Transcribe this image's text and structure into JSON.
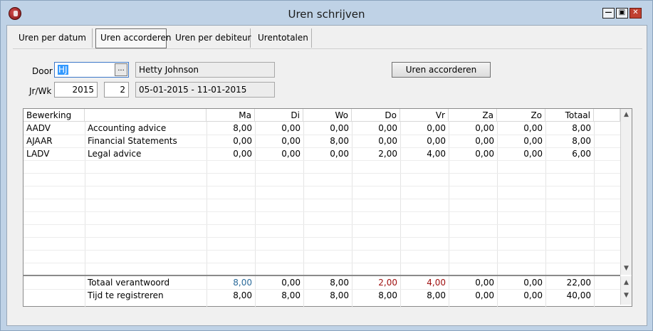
{
  "window": {
    "title": "Uren schrijven",
    "controls": {
      "minimize": "—",
      "maximize": "▣",
      "close": "✕"
    }
  },
  "tabs": [
    {
      "label": "Uren per datum",
      "active": false
    },
    {
      "label": "Uren accorderen",
      "active": true
    },
    {
      "label": "Uren per debiteur",
      "active": false
    },
    {
      "label": "Urentotalen",
      "active": false
    }
  ],
  "form": {
    "door_label": "Door",
    "door_value": "HJ",
    "browse_label": "...",
    "door_name": "Hetty Johnson",
    "jrwk_label": "Jr/Wk",
    "year": "2015",
    "week": "2",
    "period": "05-01-2015  -  11-01-2015",
    "approve_button": "Uren accorderen"
  },
  "grid": {
    "headers": [
      "Bewerking",
      "",
      "Ma",
      "Di",
      "Wo",
      "Do",
      "Vr",
      "Za",
      "Zo",
      "Totaal"
    ],
    "rows": [
      {
        "code": "AADV",
        "desc": "Accounting advice",
        "vals": [
          "8,00",
          "0,00",
          "0,00",
          "0,00",
          "0,00",
          "0,00",
          "0,00",
          "8,00"
        ]
      },
      {
        "code": "AJAAR",
        "desc": "Financial Statements",
        "vals": [
          "0,00",
          "0,00",
          "8,00",
          "0,00",
          "0,00",
          "0,00",
          "0,00",
          "8,00"
        ]
      },
      {
        "code": "LADV",
        "desc": "Legal advice",
        "vals": [
          "0,00",
          "0,00",
          "0,00",
          "2,00",
          "4,00",
          "0,00",
          "0,00",
          "6,00"
        ]
      }
    ],
    "summary": [
      {
        "label": "Totaal verantwoord",
        "vals": [
          "8,00",
          "0,00",
          "8,00",
          "2,00",
          "4,00",
          "0,00",
          "0,00",
          "22,00"
        ],
        "colors": [
          "#2a6a9a",
          "#000000",
          "#000000",
          "#a01010",
          "#a01010",
          "#000000",
          "#000000",
          "#000000"
        ]
      },
      {
        "label": "Tijd te registreren",
        "vals": [
          "8,00",
          "8,00",
          "8,00",
          "8,00",
          "8,00",
          "0,00",
          "0,00",
          "40,00"
        ],
        "colors": [
          "#000000",
          "#000000",
          "#000000",
          "#000000",
          "#000000",
          "#000000",
          "#000000",
          "#000000"
        ]
      }
    ],
    "scroll_up": "▲",
    "scroll_down": "▼"
  }
}
